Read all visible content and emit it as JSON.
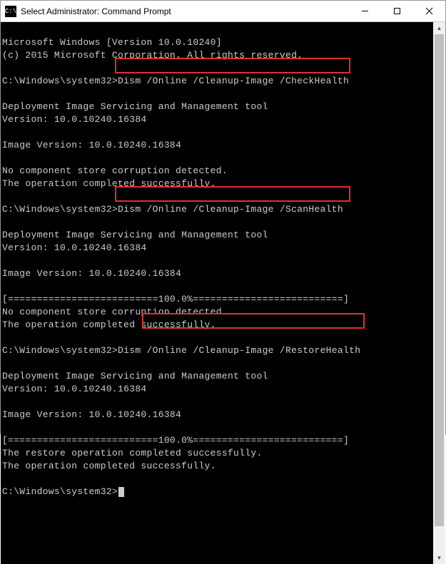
{
  "titlebar": {
    "title": "Select Administrator: Command Prompt"
  },
  "terminal": {
    "lines": {
      "l0": "Microsoft Windows [Version 10.0.10240]",
      "l1": "(c) 2015 Microsoft Corporation. All rights reserved.",
      "l2": "",
      "l3a": "C:\\Windows\\system32>Dism ",
      "l3b": "/Online /Cleanup-Image /CheckHealth",
      "l4": "",
      "l5": "Deployment Image Servicing and Management tool",
      "l6": "Version: 10.0.10240.16384",
      "l7": "",
      "l8": "Image Version: 10.0.10240.16384",
      "l9": "",
      "l10": "No component store corruption detected.",
      "l11": "The operation completed successfully.",
      "l12": "",
      "l13a": "C:\\Windows\\system32>",
      "l13b": "Dism /Online /Cleanup-Image /ScanHealth",
      "l14": "",
      "l15": "Deployment Image Servicing and Management tool",
      "l16": "Version: 10.0.10240.16384",
      "l17": "",
      "l18": "Image Version: 10.0.10240.16384",
      "l19": "",
      "l20": "[==========================100.0%==========================]",
      "l21": "No component store corruption detected.",
      "l22": "The operation completed successfully.",
      "l23": "",
      "l24a": "C:\\Windows\\system32>Dism ",
      "l24b": "/Online /Cleanup-Image /RestoreHealth",
      "l25": "",
      "l26": "Deployment Image Servicing and Management tool",
      "l27": "Version: 10.0.10240.16384",
      "l28": "",
      "l29": "Image Version: 10.0.10240.16384",
      "l30": "",
      "l31": "[==========================100.0%==========================]",
      "l32": "The restore operation completed successfully.",
      "l33": "The operation completed successfully.",
      "l34": "",
      "l35": "C:\\Windows\\system32>"
    }
  }
}
